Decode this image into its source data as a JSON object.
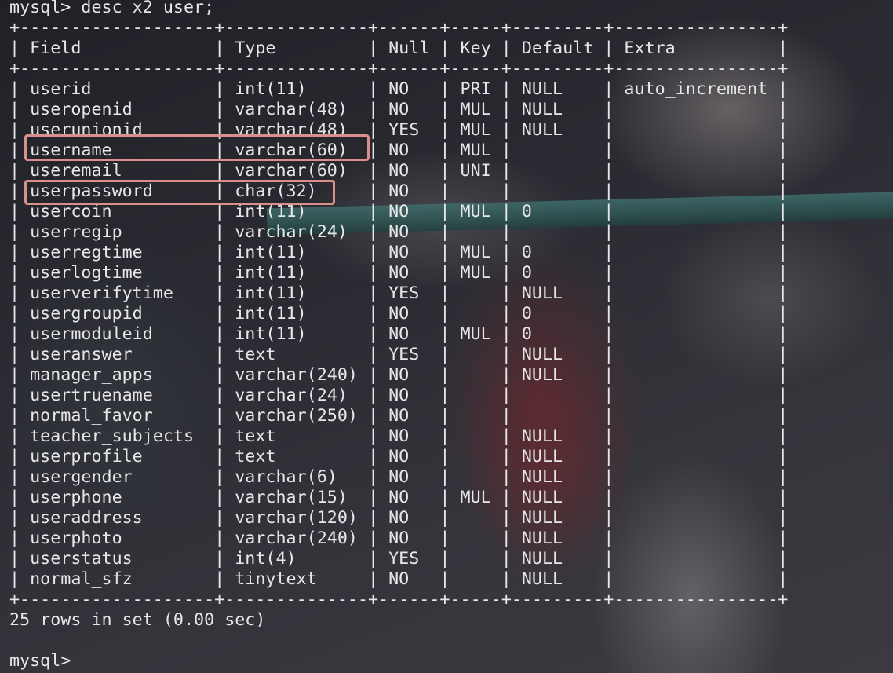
{
  "terminal": {
    "command_line": "mysql> desc x2_user;",
    "border_line": "+-------------------+--------------+------+-----+---------+----------------+",
    "header_line": "| Field             | Type         | Null | Key | Default | Extra          |",
    "rows": [
      "| userid            | int(11)      | NO   | PRI | NULL    | auto_increment |",
      "| useropenid        | varchar(48)  | NO   | MUL | NULL    |                |",
      "| userunionid       | varchar(48)  | YES  | MUL | NULL    |                |",
      "| username          | varchar(60)  | NO   | MUL |         |                |",
      "| useremail         | varchar(60)  | NO   | UNI |         |                |",
      "| userpassword      | char(32)     | NO   |     |         |                |",
      "| usercoin          | int(11)      | NO   | MUL | 0       |                |",
      "| userregip         | varchar(24)  | NO   |     |         |                |",
      "| userregtime       | int(11)      | NO   | MUL | 0       |                |",
      "| userlogtime       | int(11)      | NO   | MUL | 0       |                |",
      "| userverifytime    | int(11)      | YES  |     | NULL    |                |",
      "| usergroupid       | int(11)      | NO   |     | 0       |                |",
      "| usermoduleid      | int(11)      | NO   | MUL | 0       |                |",
      "| useranswer        | text         | YES  |     | NULL    |                |",
      "| manager_apps      | varchar(240) | NO   |     | NULL    |                |",
      "| usertruename      | varchar(24)  | NO   |     |         |                |",
      "| normal_favor      | varchar(250) | NO   |     |         |                |",
      "| teacher_subjects  | text         | NO   |     | NULL    |                |",
      "| userprofile       | text         | NO   |     | NULL    |                |",
      "| usergender        | varchar(6)   | NO   |     | NULL    |                |",
      "| userphone         | varchar(15)  | NO   | MUL | NULL    |                |",
      "| useraddress       | varchar(120) | NO   |     | NULL    |                |",
      "| userphoto         | varchar(240) | NO   |     | NULL    |                |",
      "| userstatus        | int(4)       | YES  |     | NULL    |                |",
      "| normal_sfz        | tinytext     | NO   |     | NULL    |                |"
    ],
    "result_line": "25 rows in set (0.00 sec)",
    "prompt": "mysql>"
  },
  "highlight_color": "#d98f8a",
  "highlighted_fields": [
    "username",
    "userpassword"
  ]
}
